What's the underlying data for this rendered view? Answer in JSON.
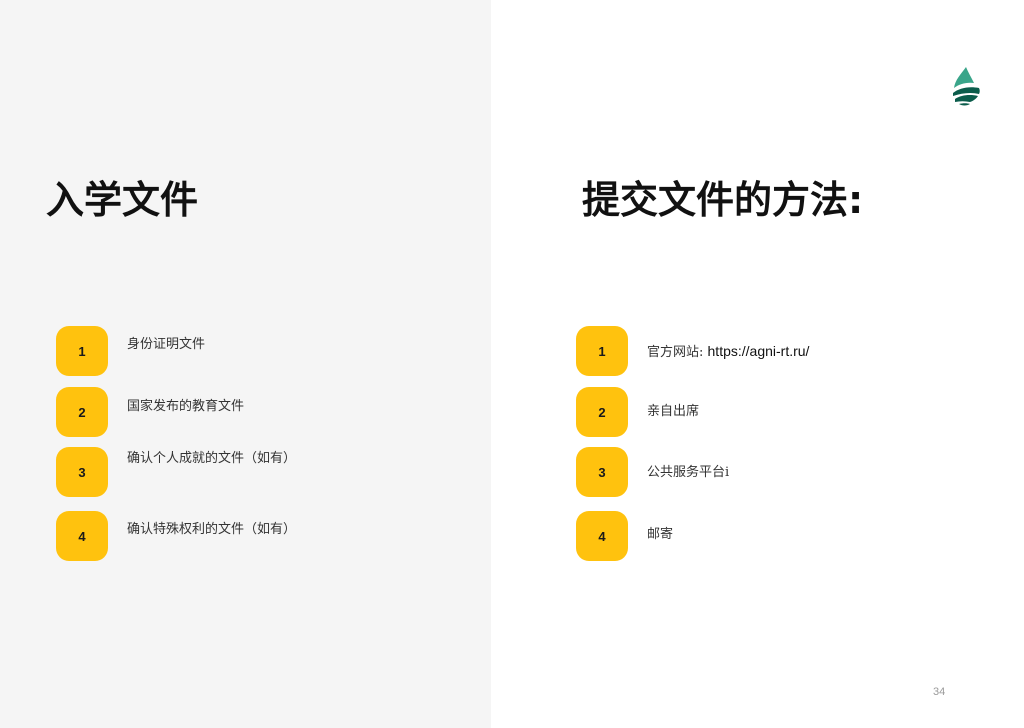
{
  "left": {
    "title": "入学文件",
    "items": [
      {
        "number": "1",
        "text": "身份证明文件"
      },
      {
        "number": "2",
        "text": "国家发布的教育文件"
      },
      {
        "number": "3",
        "text": "确认个人成就的文件（如有）"
      },
      {
        "number": "4",
        "text": "确认特殊权利的文件（如有）"
      }
    ]
  },
  "right": {
    "title": "提交文件的方法:",
    "items": [
      {
        "number": "1",
        "prefix": "官方网站: ",
        "link": "https://agni-rt.ru/"
      },
      {
        "number": "2",
        "text": "亲自出席"
      },
      {
        "number": "3",
        "text": "公共服务平台i"
      },
      {
        "number": "4",
        "text": "邮寄"
      }
    ]
  },
  "page_number": "34",
  "logo_icon": "green-drop-logo-icon",
  "colors": {
    "badge": "#ffc20e",
    "left_panel": "#f5f5f5",
    "logo_dark": "#0b5c4b",
    "logo_light": "#3aa58a"
  }
}
